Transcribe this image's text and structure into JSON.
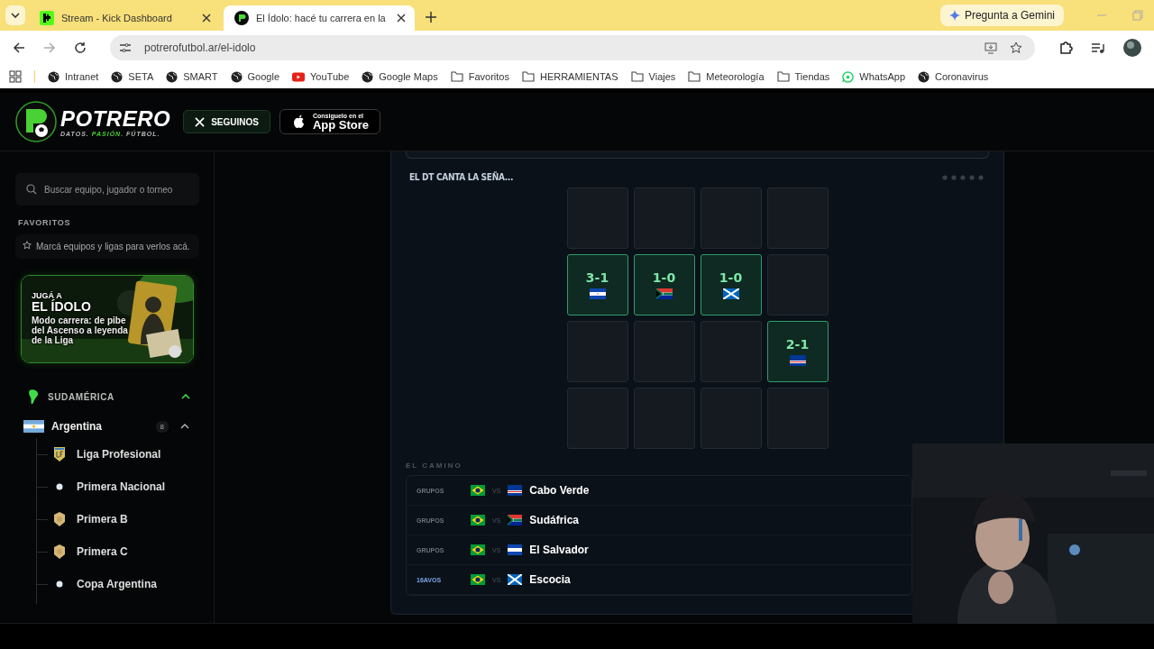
{
  "browser": {
    "tabs": [
      {
        "title": "Stream - Kick Dashboard",
        "selected": false
      },
      {
        "title": "El Ídolo: hacé tu carrera en la",
        "selected": true
      }
    ],
    "gemini": "Pregunta a Gemini",
    "url": "potrerofutbol.ar/el-idolo",
    "bookmarks": [
      {
        "label": "Intranet",
        "kind": "globe"
      },
      {
        "label": "SETA",
        "kind": "globe"
      },
      {
        "label": "SMART",
        "kind": "globe"
      },
      {
        "label": "Google",
        "kind": "globe"
      },
      {
        "label": "YouTube",
        "kind": "youtube"
      },
      {
        "label": "Google Maps",
        "kind": "globe"
      },
      {
        "label": "Favoritos",
        "kind": "folder"
      },
      {
        "label": "HERRAMIENTAS",
        "kind": "folder"
      },
      {
        "label": "Viajes",
        "kind": "folder"
      },
      {
        "label": "Meteorología",
        "kind": "folder"
      },
      {
        "label": "Tiendas",
        "kind": "folder"
      },
      {
        "label": "WhatsApp",
        "kind": "whatsapp"
      },
      {
        "label": "Coronavirus",
        "kind": "globe"
      }
    ]
  },
  "header": {
    "logo": "POTRERO",
    "tagline": [
      "DATOS.",
      "PASIÓN.",
      "FÚTBOL."
    ],
    "follow": "SEGUINOS",
    "store_small": "Consiguelo en el",
    "store_big": "App Store"
  },
  "sidebar": {
    "search": {
      "placeholder": "Buscar equipo, jugador o torneo"
    },
    "favorites_title": "FAVORITOS",
    "favorites_note": "Marcá equipos y ligas para verlos acá.",
    "promo": {
      "kicker": "JUGÁ A",
      "title": "EL ÍDOLO",
      "text": "Modo carrera: de pibe del Ascenso a leyenda de la Liga"
    },
    "tree": [
      {
        "label": "SUDAMÉRICA",
        "expanded": true,
        "children": [
          {
            "label": "Argentina",
            "count": "8",
            "expanded": true,
            "children": [
              {
                "label": "Liga Profesional",
                "kind": "shield"
              },
              {
                "label": "Primera Nacional",
                "kind": "dot"
              },
              {
                "label": "Primera B",
                "kind": "badge"
              },
              {
                "label": "Primera C",
                "kind": "badge"
              },
              {
                "label": "Copa Argentina",
                "kind": "dot"
              }
            ]
          }
        ]
      }
    ]
  },
  "game": {
    "title": "EL DT CANTA LA SEÑA...",
    "grid": [
      {
        "kind": "empty"
      },
      {
        "kind": "empty"
      },
      {
        "kind": "empty"
      },
      {
        "kind": "empty"
      },
      {
        "kind": "el-salvador",
        "score": "3-1"
      },
      {
        "kind": "south-africa",
        "score": "1-0"
      },
      {
        "kind": "scotland",
        "score": "1-0"
      },
      {
        "kind": "empty"
      },
      {
        "kind": "empty"
      },
      {
        "kind": "empty"
      },
      {
        "kind": "empty"
      },
      {
        "kind": "cape-verde",
        "score": "2-1"
      },
      {
        "kind": "empty"
      },
      {
        "kind": "empty"
      },
      {
        "kind": "empty"
      },
      {
        "kind": "empty"
      }
    ],
    "route_title": "EL CAMINO",
    "route": [
      {
        "stage": "GRUPOS",
        "highlighted": false,
        "vs": "VS",
        "kind": "cape-verde",
        "opponent": "Cabo Verde"
      },
      {
        "stage": "GRUPOS",
        "highlighted": false,
        "vs": "VS",
        "kind": "south-africa",
        "opponent": "Sudáfrica"
      },
      {
        "stage": "GRUPOS",
        "highlighted": false,
        "vs": "VS",
        "kind": "el-salvador",
        "opponent": "El Salvador"
      },
      {
        "stage": "16AVOS",
        "highlighted": true,
        "vs": "VS",
        "kind": "scotland",
        "opponent": "Escocia"
      }
    ]
  }
}
